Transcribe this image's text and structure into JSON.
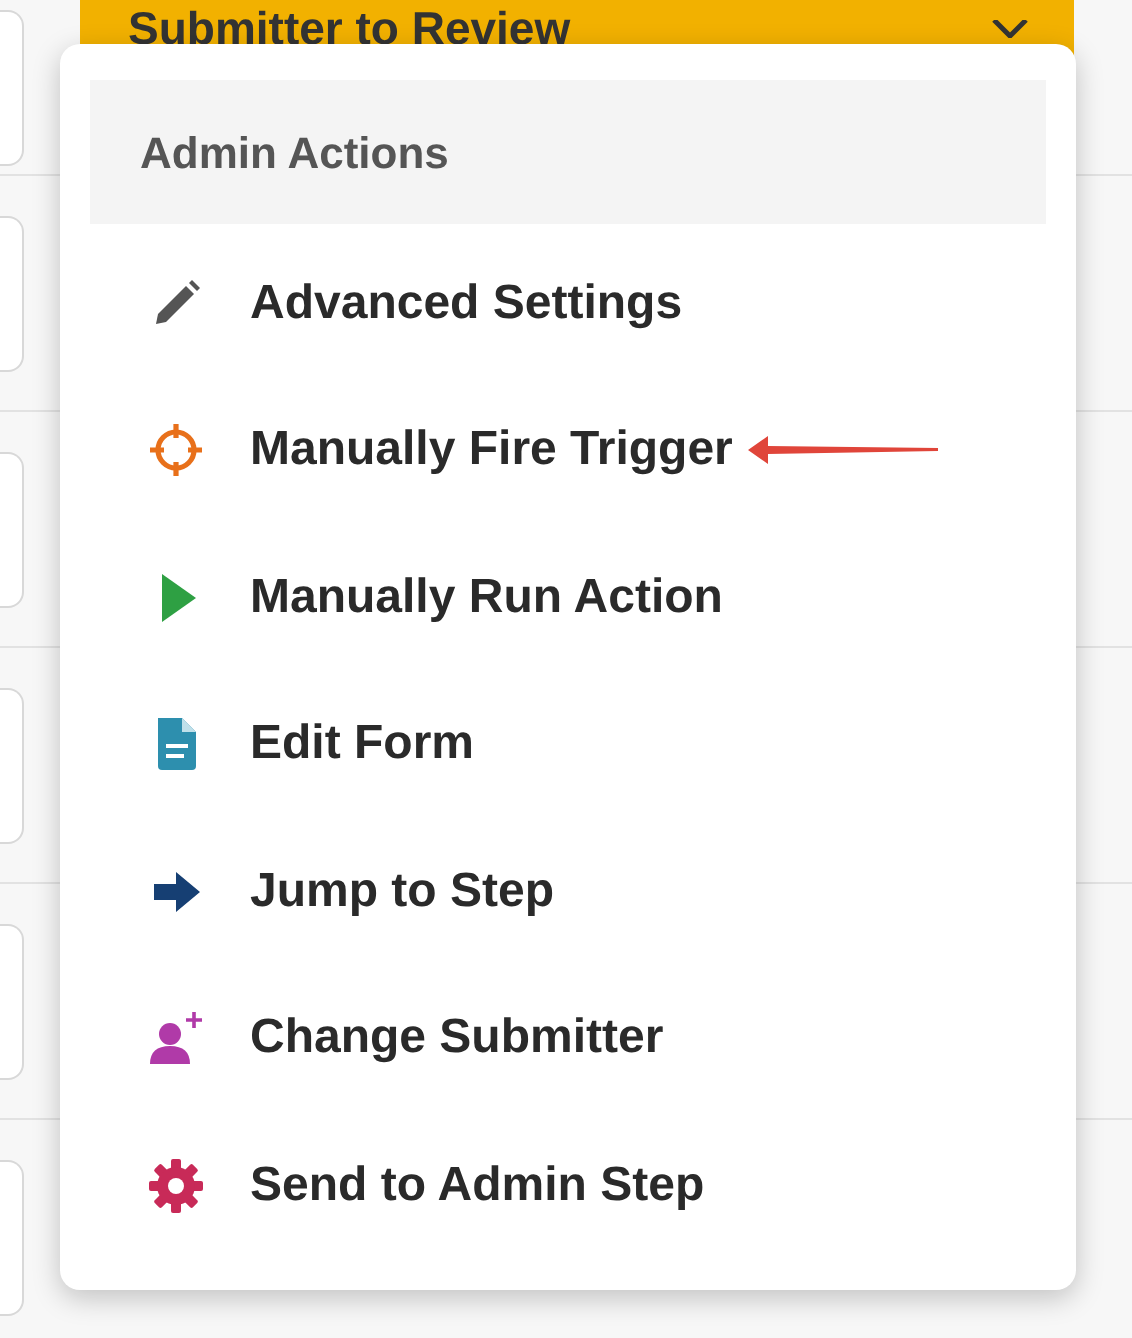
{
  "stage_bar": {
    "title": "Submitter to Review"
  },
  "menu": {
    "header": "Admin Actions",
    "items": [
      {
        "label": "Advanced Settings",
        "annotated": false
      },
      {
        "label": "Manually Fire Trigger",
        "annotated": true
      },
      {
        "label": "Manually Run Action",
        "annotated": false
      },
      {
        "label": "Edit Form",
        "annotated": false
      },
      {
        "label": "Jump to Step",
        "annotated": false
      },
      {
        "label": "Change Submitter",
        "annotated": false
      },
      {
        "label": "Send to Admin Step",
        "annotated": false
      }
    ]
  }
}
